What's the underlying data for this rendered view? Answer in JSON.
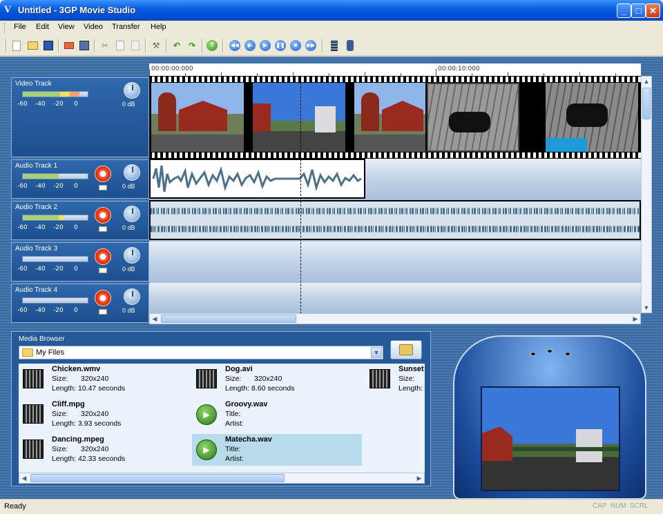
{
  "window": {
    "title": "Untitled - 3GP Movie Studio",
    "app_icon": "V"
  },
  "menu": [
    "File",
    "Edit",
    "View",
    "Video",
    "Transfer",
    "Help"
  ],
  "toolbar": {
    "buttons": [
      "new-icon",
      "open-icon",
      "save-icon",
      "import-icon",
      "export-icon",
      "cut-icon",
      "copy-icon",
      "paste-icon",
      "properties-icon",
      "undo-icon",
      "redo-icon",
      "help-icon",
      "rewind-start-icon",
      "play-icon",
      "play-selection-icon",
      "pause-icon",
      "stop-icon",
      "forward-end-icon",
      "clip-icon",
      "phone-icon"
    ],
    "help_glyph": "?"
  },
  "timeline": {
    "ruler_labels": [
      "00:00:00:000",
      "00:00:10:000"
    ]
  },
  "tracks": [
    {
      "name": "Video Track",
      "scale": [
        "-60",
        "-40",
        "-20",
        "0"
      ],
      "volume": "0 dB",
      "meter_fill": 0.85,
      "meter_color": "yellow-red"
    },
    {
      "name": "Audio Track 1",
      "scale": [
        "-60",
        "-40",
        "-20",
        "0"
      ],
      "volume": "0 dB",
      "meter_fill": 0.55,
      "meter_color": "green"
    },
    {
      "name": "Audio Track 2",
      "scale": [
        "-60",
        "-40",
        "-20",
        "0"
      ],
      "volume": "0 dB",
      "meter_fill": 0.62,
      "meter_color": "green-yellow"
    },
    {
      "name": "Audio Track 3",
      "scale": [
        "-60",
        "-40",
        "-20",
        "0"
      ],
      "volume": "0 dB",
      "meter_fill": 0,
      "meter_color": "none"
    },
    {
      "name": "Audio Track 4",
      "scale": [
        "-60",
        "-40",
        "-20",
        "0"
      ],
      "volume": "0 dB",
      "meter_fill": 0,
      "meter_color": "none"
    }
  ],
  "media_browser": {
    "title": "Media Browser",
    "folder": "My Files",
    "files": [
      {
        "name": "Chicken.wmv",
        "type": "video",
        "k1": "Size:",
        "v1": "320x240",
        "k2": "Length:",
        "v2": "10.47 seconds"
      },
      {
        "name": "Dog.avi",
        "type": "video",
        "k1": "Size:",
        "v1": "320x240",
        "k2": "Length:",
        "v2": "8.60 seconds"
      },
      {
        "name": "Sunset",
        "type": "video",
        "k1": "Size:",
        "v1": "",
        "k2": "Length:",
        "v2": ""
      },
      {
        "name": "Cliff.mpg",
        "type": "video",
        "k1": "Size:",
        "v1": "320x240",
        "k2": "Length:",
        "v2": "3.93 seconds"
      },
      {
        "name": "Groovy.wav",
        "type": "audio",
        "k1": "Title:",
        "v1": "",
        "k2": "Artist:",
        "v2": ""
      },
      {
        "name": "Dancing.mpeg",
        "type": "video",
        "k1": "Size:",
        "v1": "320x240",
        "k2": "Length:",
        "v2": "42.33 seconds"
      },
      {
        "name": "Matecha.wav",
        "type": "audio",
        "k1": "Title:",
        "v1": "",
        "k2": "Artist:",
        "v2": "",
        "selected": true
      }
    ]
  },
  "status": {
    "text": "Ready",
    "indicators": [
      "CAP",
      "NUM",
      "SCRL"
    ]
  },
  "colors": {
    "accent": "#0a5fe0",
    "panel": "#26599a",
    "track_bg": "#2f68ac",
    "selected_file": "#b8dcec"
  }
}
